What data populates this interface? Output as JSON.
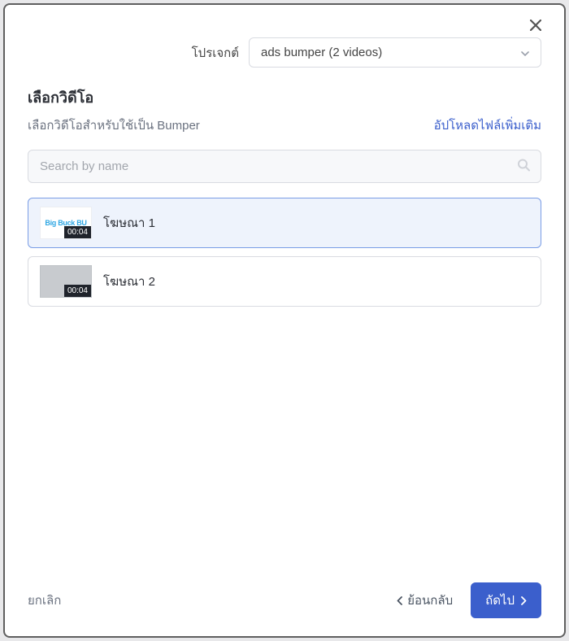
{
  "header": {
    "projectLabel": "โปรเจกต์",
    "projectValue": "ads bumper (2 videos)"
  },
  "section": {
    "title": "เลือกวิดีโอ",
    "subtitle": "เลือกวิดีโอสำหรับใช้เป็น Bumper",
    "uploadLabel": "อัปโหลดไฟล์เพิ่มเติม"
  },
  "search": {
    "placeholder": "Search by name"
  },
  "videos": {
    "item0": {
      "name": "โฆษณา 1",
      "duration": "00:04",
      "thumbText": "Big Buck\nBU"
    },
    "item1": {
      "name": "โฆษณา 2",
      "duration": "00:04"
    }
  },
  "footer": {
    "cancel": "ยกเลิก",
    "back": "ย้อนกลับ",
    "next": "ถัดไป"
  }
}
